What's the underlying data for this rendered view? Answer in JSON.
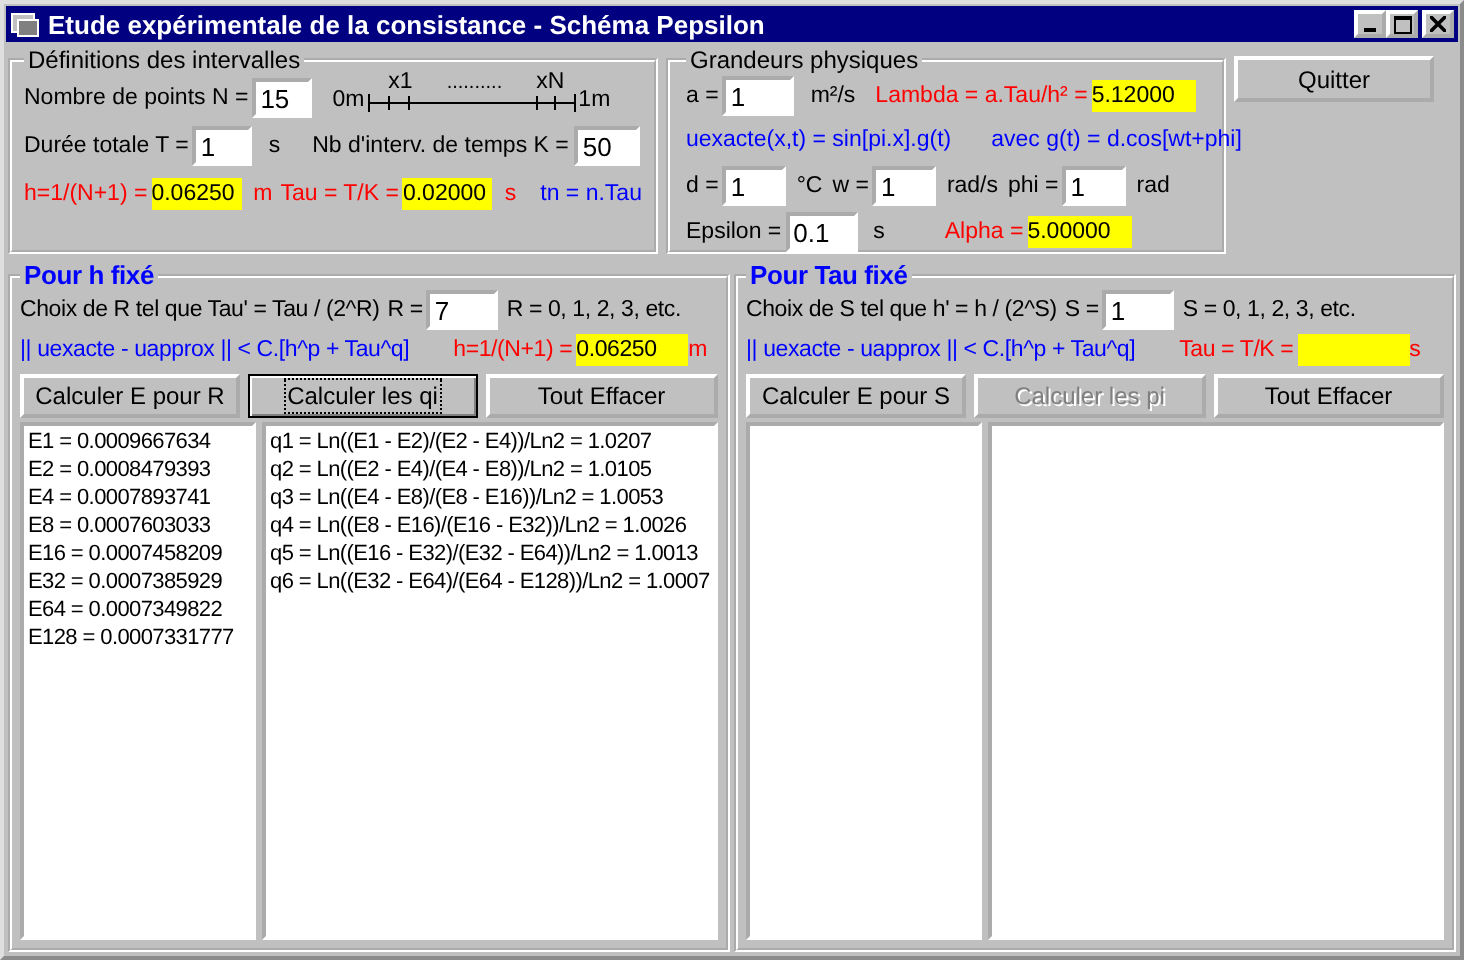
{
  "window": {
    "title": "Etude expérimentale de la consistance - Schéma Pepsilon"
  },
  "intervals": {
    "title": "Définitions des intervalles",
    "n": {
      "label": "Nombre de points  N =",
      "value": "15"
    },
    "diagram": {
      "start": "0m",
      "end": "1m",
      "first": "x1",
      "last": "xN",
      "dots": ".........."
    },
    "t": {
      "label": "Durée totale T =",
      "value": "1",
      "unit": "s"
    },
    "k": {
      "label": "Nb d'interv. de temps K =",
      "value": "50"
    },
    "h": {
      "label": "h=1/(N+1) =",
      "value": "0.06250",
      "unit": "m"
    },
    "tau": {
      "label": "Tau = T/K =",
      "value": "0.02000",
      "unit": "s"
    },
    "tn": "tn = n.Tau"
  },
  "physics": {
    "title": "Grandeurs physiques",
    "a": {
      "label": "a =",
      "value": "1",
      "unit": "m²/s"
    },
    "lambda": {
      "label": "Lambda = a.Tau/h² =",
      "value": "5.12000"
    },
    "exact": "uexacte(x,t) = sin[pi.x].g(t)",
    "g": "avec g(t) = d.cos[wt+phi]",
    "params": [
      {
        "label": "d =",
        "value": "1",
        "unit": "°C"
      },
      {
        "label": "w =",
        "value": "1",
        "unit": "rad/s"
      },
      {
        "label": "phi =",
        "value": "1",
        "unit": "rad"
      }
    ],
    "epsilon": {
      "label": "Epsilon =",
      "value": "0.1",
      "unit": "s"
    },
    "alpha": {
      "label": "Alpha =",
      "value": "5.00000"
    }
  },
  "quit_button": "Quitter",
  "panels": [
    {
      "title": "Pour h fixé",
      "choice": "Choix de R tel que Tau' = Tau / (2^R)",
      "param_label": "R =",
      "param_value": "7",
      "range": "R = 0, 1, 2, 3, etc.",
      "norm": "|| uexacte - uapprox || < C.[h^p + Tau^q]",
      "result": {
        "label": "h=1/(N+1) =",
        "value": "0.06250",
        "unit": "m"
      },
      "buttons": [
        {
          "label": "Calculer E pour R",
          "disabled": false,
          "focused": false
        },
        {
          "label": "Calculer les qi",
          "disabled": false,
          "focused": true
        },
        {
          "label": "Tout Effacer",
          "disabled": false,
          "focused": false
        }
      ],
      "errors": [
        "E1 = 0.0009667634",
        "E2 = 0.0008479393",
        "E4 = 0.0007893741",
        "E8 = 0.0007603033",
        "E16 = 0.0007458209",
        "E32 = 0.0007385929",
        "E64 = 0.0007349822",
        "E128 = 0.0007331777"
      ],
      "orders": [
        "q1 = Ln((E1 - E2)/(E2 - E4))/Ln2 = 1.0207",
        "q2 = Ln((E2 - E4)/(E4 - E8))/Ln2 = 1.0105",
        "q3 = Ln((E4 - E8)/(E8 - E16))/Ln2 = 1.0053",
        "q4 = Ln((E8 - E16)/(E16 - E32))/Ln2 = 1.0026",
        "q5 = Ln((E16 - E32)/(E32 - E64))/Ln2 = 1.0013",
        "q6 = Ln((E32 - E64)/(E64 - E128))/Ln2 = 1.0007"
      ]
    },
    {
      "title": "Pour Tau fixé",
      "choice": "Choix de S tel que h' = h / (2^S)",
      "param_label": "S =",
      "param_value": "1",
      "range": "S = 0, 1, 2, 3, etc.",
      "norm": "|| uexacte - uapprox || < C.[h^p + Tau^q]",
      "result": {
        "label": "Tau = T/K =",
        "unit": "s"
      },
      "buttons": [
        {
          "label": "Calculer E pour S",
          "disabled": false,
          "focused": false
        },
        {
          "label": "Calculer les pi",
          "disabled": true,
          "focused": false
        },
        {
          "label": "Tout Effacer",
          "disabled": false,
          "focused": false
        }
      ]
    }
  ]
}
